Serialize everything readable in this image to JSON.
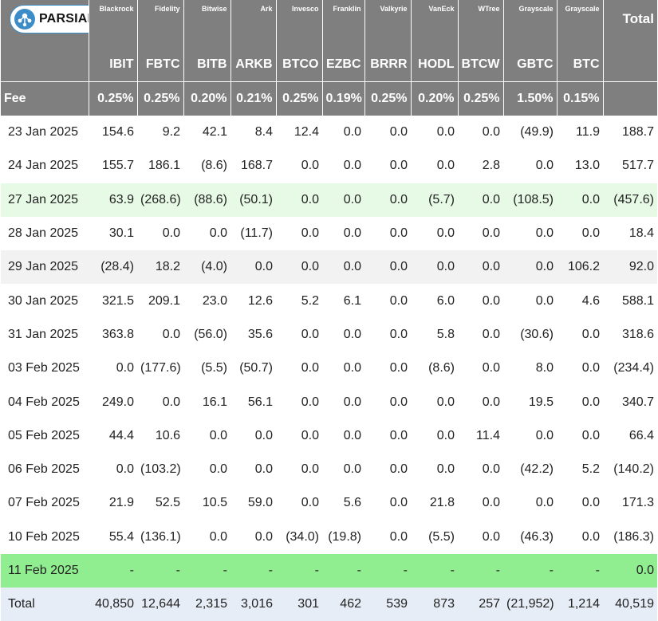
{
  "brand": {
    "name": "PARSIANCRYPTO.COM"
  },
  "issuers": [
    "Blackrock",
    "Fidelity",
    "Bitwise",
    "Ark",
    "Invesco",
    "Franklin",
    "Valkyrie",
    "VanEck",
    "WTree",
    "Grayscale",
    "Grayscale"
  ],
  "total_label": "Total",
  "tickers": [
    "IBIT",
    "FBTC",
    "BITB",
    "ARKB",
    "BTCO",
    "EZBC",
    "BRRR",
    "HODL",
    "BTCW",
    "GBTC",
    "BTC"
  ],
  "fee_label": "Fee",
  "fees": [
    "0.25%",
    "0.25%",
    "0.20%",
    "0.21%",
    "0.25%",
    "0.19%",
    "0.25%",
    "0.20%",
    "0.25%",
    "1.50%",
    "0.15%"
  ],
  "rows": [
    {
      "date": "23 Jan 2025",
      "values": [
        "154.6",
        "9.2",
        "42.1",
        "8.4",
        "12.4",
        "0.0",
        "0.0",
        "0.0",
        "0.0",
        "(49.9)",
        "11.9"
      ],
      "total": "188.7"
    },
    {
      "date": "24 Jan 2025",
      "values": [
        "155.7",
        "186.1",
        "(8.6)",
        "168.7",
        "0.0",
        "0.0",
        "0.0",
        "0.0",
        "2.8",
        "0.0",
        "13.0"
      ],
      "total": "517.7"
    },
    {
      "date": "27 Jan 2025",
      "values": [
        "63.9",
        "(268.6)",
        "(88.6)",
        "(50.1)",
        "0.0",
        "0.0",
        "0.0",
        "(5.7)",
        "0.0",
        "(108.5)",
        "0.0"
      ],
      "total": "(457.6)"
    },
    {
      "date": "28 Jan 2025",
      "values": [
        "30.1",
        "0.0",
        "0.0",
        "(11.7)",
        "0.0",
        "0.0",
        "0.0",
        "0.0",
        "0.0",
        "0.0",
        "0.0"
      ],
      "total": "18.4"
    },
    {
      "date": "29 Jan 2025",
      "values": [
        "(28.4)",
        "18.2",
        "(4.0)",
        "0.0",
        "0.0",
        "0.0",
        "0.0",
        "0.0",
        "0.0",
        "0.0",
        "106.2"
      ],
      "total": "92.0"
    },
    {
      "date": "30 Jan 2025",
      "values": [
        "321.5",
        "209.1",
        "23.0",
        "12.6",
        "5.2",
        "6.1",
        "0.0",
        "6.0",
        "0.0",
        "0.0",
        "4.6"
      ],
      "total": "588.1"
    },
    {
      "date": "31 Jan 2025",
      "values": [
        "363.8",
        "0.0",
        "(56.0)",
        "35.6",
        "0.0",
        "0.0",
        "0.0",
        "5.8",
        "0.0",
        "(30.6)",
        "0.0"
      ],
      "total": "318.6"
    },
    {
      "date": "03 Feb 2025",
      "values": [
        "0.0",
        "(177.6)",
        "(5.5)",
        "(50.7)",
        "0.0",
        "0.0",
        "0.0",
        "(8.6)",
        "0.0",
        "8.0",
        "0.0"
      ],
      "total": "(234.4)"
    },
    {
      "date": "04 Feb 2025",
      "values": [
        "249.0",
        "0.0",
        "16.1",
        "56.1",
        "0.0",
        "0.0",
        "0.0",
        "0.0",
        "0.0",
        "19.5",
        "0.0"
      ],
      "total": "340.7"
    },
    {
      "date": "05 Feb 2025",
      "values": [
        "44.4",
        "10.6",
        "0.0",
        "0.0",
        "0.0",
        "0.0",
        "0.0",
        "0.0",
        "11.4",
        "0.0",
        "0.0"
      ],
      "total": "66.4"
    },
    {
      "date": "06 Feb 2025",
      "values": [
        "0.0",
        "(103.2)",
        "0.0",
        "0.0",
        "0.0",
        "0.0",
        "0.0",
        "0.0",
        "0.0",
        "(42.2)",
        "5.2"
      ],
      "total": "(140.2)"
    },
    {
      "date": "07 Feb 2025",
      "values": [
        "21.9",
        "52.5",
        "10.5",
        "59.0",
        "0.0",
        "5.6",
        "0.0",
        "21.8",
        "0.0",
        "0.0",
        "0.0"
      ],
      "total": "171.3"
    },
    {
      "date": "10 Feb 2025",
      "values": [
        "55.4",
        "(136.1)",
        "0.0",
        "0.0",
        "(34.0)",
        "(19.8)",
        "0.0",
        "(5.5)",
        "0.0",
        "(46.3)",
        "0.0"
      ],
      "total": "(186.3)"
    },
    {
      "date": "11 Feb 2025",
      "values": [
        "-",
        "-",
        "-",
        "-",
        "-",
        "-",
        "-",
        "-",
        "-",
        "-",
        "-"
      ],
      "total": "0.0"
    }
  ],
  "totals": {
    "label": "Total",
    "values": [
      "40,850",
      "12,644",
      "2,315",
      "3,016",
      "301",
      "462",
      "539",
      "873",
      "257",
      "(21,952)",
      "1,214"
    ],
    "total": "40,519"
  },
  "colors": {
    "header_bg": "#7f7f7f",
    "negative": "#e21b1b",
    "row_shade": "#f2f2f2",
    "row_green": "#e6fae6",
    "row_bright_green": "#90ee90",
    "total_row_bg": "#e7edf6",
    "logo_blue": "#3c8cc8"
  },
  "icons": {
    "logo": "bitcoin-network-logo-icon"
  }
}
